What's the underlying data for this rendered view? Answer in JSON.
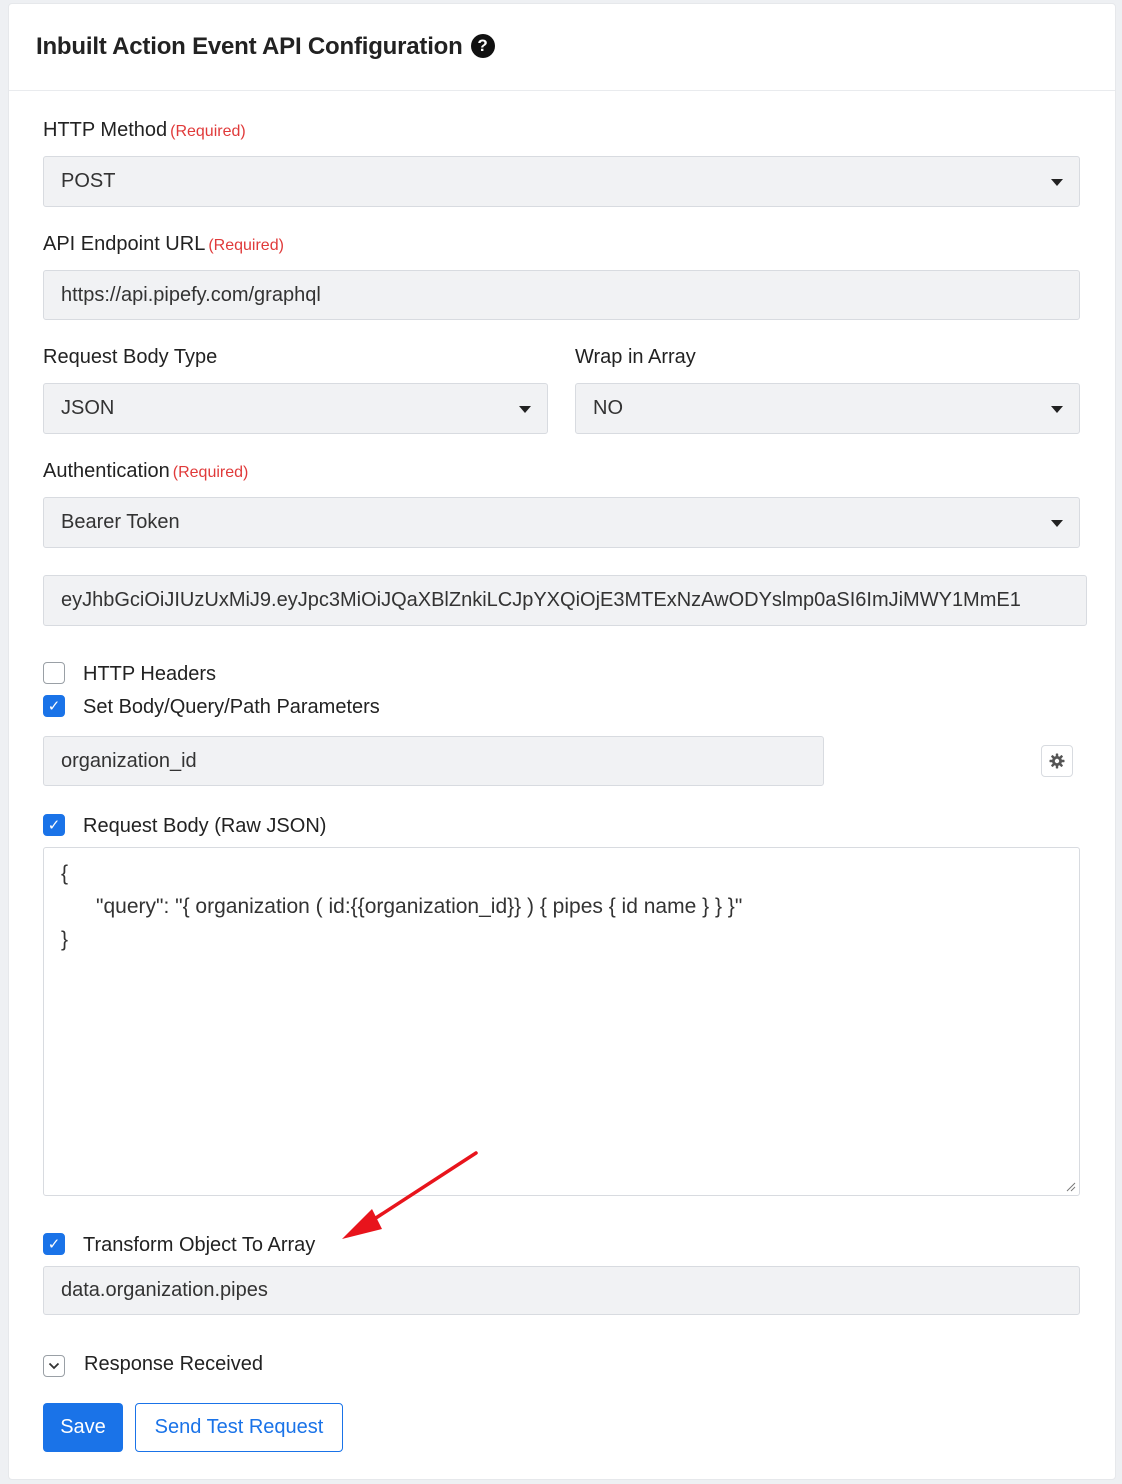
{
  "header": {
    "title": "Inbuilt Action Event API Configuration"
  },
  "required_text": "(Required)",
  "http_method": {
    "label": "HTTP Method",
    "value": "POST"
  },
  "endpoint": {
    "label": "API Endpoint URL",
    "value": "https://api.pipefy.com/graphql"
  },
  "body_type": {
    "label": "Request Body Type",
    "value": "JSON"
  },
  "wrap_array": {
    "label": "Wrap in Array",
    "value": "NO"
  },
  "auth": {
    "label": "Authentication",
    "value": "Bearer Token",
    "token": "eyJhbGciOiJIUzUxMiJ9.eyJpc3MiOiJQaXBlZnkiLCJpYXQiOjE3MTExNzAwODYslmp0aSI6ImJiMWY1MmE1"
  },
  "options": {
    "http_headers": {
      "label": "HTTP Headers",
      "checked": false
    },
    "set_params": {
      "label": "Set Body/Query/Path Parameters",
      "checked": true,
      "param_value": "organization_id"
    },
    "raw_json": {
      "label": "Request Body (Raw JSON)",
      "checked": true,
      "lines": [
        "{",
        "      \"query\": \"{ organization ( id:{{organization_id}} ) { pipes { id name } } }\"",
        "}"
      ]
    },
    "transform": {
      "label": "Transform Object To Array",
      "checked": true,
      "value": "data.organization.pipes"
    },
    "response": {
      "label": "Response Received"
    }
  },
  "actions": {
    "save_label": "Save",
    "test_label": "Send Test Request"
  },
  "colors": {
    "accent": "#1a73e8",
    "required": "#e03a3a",
    "arrow": "#e8141c"
  }
}
